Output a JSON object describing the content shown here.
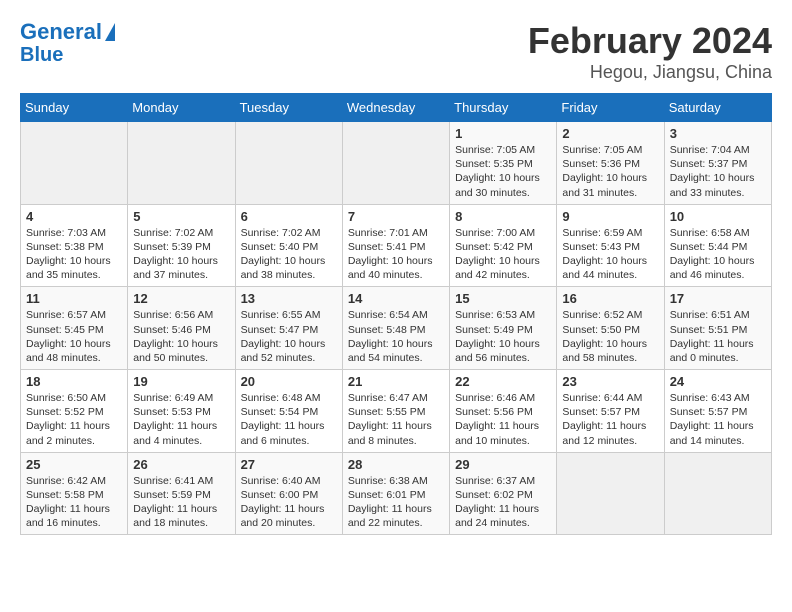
{
  "header": {
    "logo_line1": "General",
    "logo_line2": "Blue",
    "title": "February 2024",
    "subtitle": "Hegou, Jiangsu, China"
  },
  "days_of_week": [
    "Sunday",
    "Monday",
    "Tuesday",
    "Wednesday",
    "Thursday",
    "Friday",
    "Saturday"
  ],
  "weeks": [
    [
      {
        "day": "",
        "info": ""
      },
      {
        "day": "",
        "info": ""
      },
      {
        "day": "",
        "info": ""
      },
      {
        "day": "",
        "info": ""
      },
      {
        "day": "1",
        "info": "Sunrise: 7:05 AM\nSunset: 5:35 PM\nDaylight: 10 hours\nand 30 minutes."
      },
      {
        "day": "2",
        "info": "Sunrise: 7:05 AM\nSunset: 5:36 PM\nDaylight: 10 hours\nand 31 minutes."
      },
      {
        "day": "3",
        "info": "Sunrise: 7:04 AM\nSunset: 5:37 PM\nDaylight: 10 hours\nand 33 minutes."
      }
    ],
    [
      {
        "day": "4",
        "info": "Sunrise: 7:03 AM\nSunset: 5:38 PM\nDaylight: 10 hours\nand 35 minutes."
      },
      {
        "day": "5",
        "info": "Sunrise: 7:02 AM\nSunset: 5:39 PM\nDaylight: 10 hours\nand 37 minutes."
      },
      {
        "day": "6",
        "info": "Sunrise: 7:02 AM\nSunset: 5:40 PM\nDaylight: 10 hours\nand 38 minutes."
      },
      {
        "day": "7",
        "info": "Sunrise: 7:01 AM\nSunset: 5:41 PM\nDaylight: 10 hours\nand 40 minutes."
      },
      {
        "day": "8",
        "info": "Sunrise: 7:00 AM\nSunset: 5:42 PM\nDaylight: 10 hours\nand 42 minutes."
      },
      {
        "day": "9",
        "info": "Sunrise: 6:59 AM\nSunset: 5:43 PM\nDaylight: 10 hours\nand 44 minutes."
      },
      {
        "day": "10",
        "info": "Sunrise: 6:58 AM\nSunset: 5:44 PM\nDaylight: 10 hours\nand 46 minutes."
      }
    ],
    [
      {
        "day": "11",
        "info": "Sunrise: 6:57 AM\nSunset: 5:45 PM\nDaylight: 10 hours\nand 48 minutes."
      },
      {
        "day": "12",
        "info": "Sunrise: 6:56 AM\nSunset: 5:46 PM\nDaylight: 10 hours\nand 50 minutes."
      },
      {
        "day": "13",
        "info": "Sunrise: 6:55 AM\nSunset: 5:47 PM\nDaylight: 10 hours\nand 52 minutes."
      },
      {
        "day": "14",
        "info": "Sunrise: 6:54 AM\nSunset: 5:48 PM\nDaylight: 10 hours\nand 54 minutes."
      },
      {
        "day": "15",
        "info": "Sunrise: 6:53 AM\nSunset: 5:49 PM\nDaylight: 10 hours\nand 56 minutes."
      },
      {
        "day": "16",
        "info": "Sunrise: 6:52 AM\nSunset: 5:50 PM\nDaylight: 10 hours\nand 58 minutes."
      },
      {
        "day": "17",
        "info": "Sunrise: 6:51 AM\nSunset: 5:51 PM\nDaylight: 11 hours\nand 0 minutes."
      }
    ],
    [
      {
        "day": "18",
        "info": "Sunrise: 6:50 AM\nSunset: 5:52 PM\nDaylight: 11 hours\nand 2 minutes."
      },
      {
        "day": "19",
        "info": "Sunrise: 6:49 AM\nSunset: 5:53 PM\nDaylight: 11 hours\nand 4 minutes."
      },
      {
        "day": "20",
        "info": "Sunrise: 6:48 AM\nSunset: 5:54 PM\nDaylight: 11 hours\nand 6 minutes."
      },
      {
        "day": "21",
        "info": "Sunrise: 6:47 AM\nSunset: 5:55 PM\nDaylight: 11 hours\nand 8 minutes."
      },
      {
        "day": "22",
        "info": "Sunrise: 6:46 AM\nSunset: 5:56 PM\nDaylight: 11 hours\nand 10 minutes."
      },
      {
        "day": "23",
        "info": "Sunrise: 6:44 AM\nSunset: 5:57 PM\nDaylight: 11 hours\nand 12 minutes."
      },
      {
        "day": "24",
        "info": "Sunrise: 6:43 AM\nSunset: 5:57 PM\nDaylight: 11 hours\nand 14 minutes."
      }
    ],
    [
      {
        "day": "25",
        "info": "Sunrise: 6:42 AM\nSunset: 5:58 PM\nDaylight: 11 hours\nand 16 minutes."
      },
      {
        "day": "26",
        "info": "Sunrise: 6:41 AM\nSunset: 5:59 PM\nDaylight: 11 hours\nand 18 minutes."
      },
      {
        "day": "27",
        "info": "Sunrise: 6:40 AM\nSunset: 6:00 PM\nDaylight: 11 hours\nand 20 minutes."
      },
      {
        "day": "28",
        "info": "Sunrise: 6:38 AM\nSunset: 6:01 PM\nDaylight: 11 hours\nand 22 minutes."
      },
      {
        "day": "29",
        "info": "Sunrise: 6:37 AM\nSunset: 6:02 PM\nDaylight: 11 hours\nand 24 minutes."
      },
      {
        "day": "",
        "info": ""
      },
      {
        "day": "",
        "info": ""
      }
    ]
  ]
}
